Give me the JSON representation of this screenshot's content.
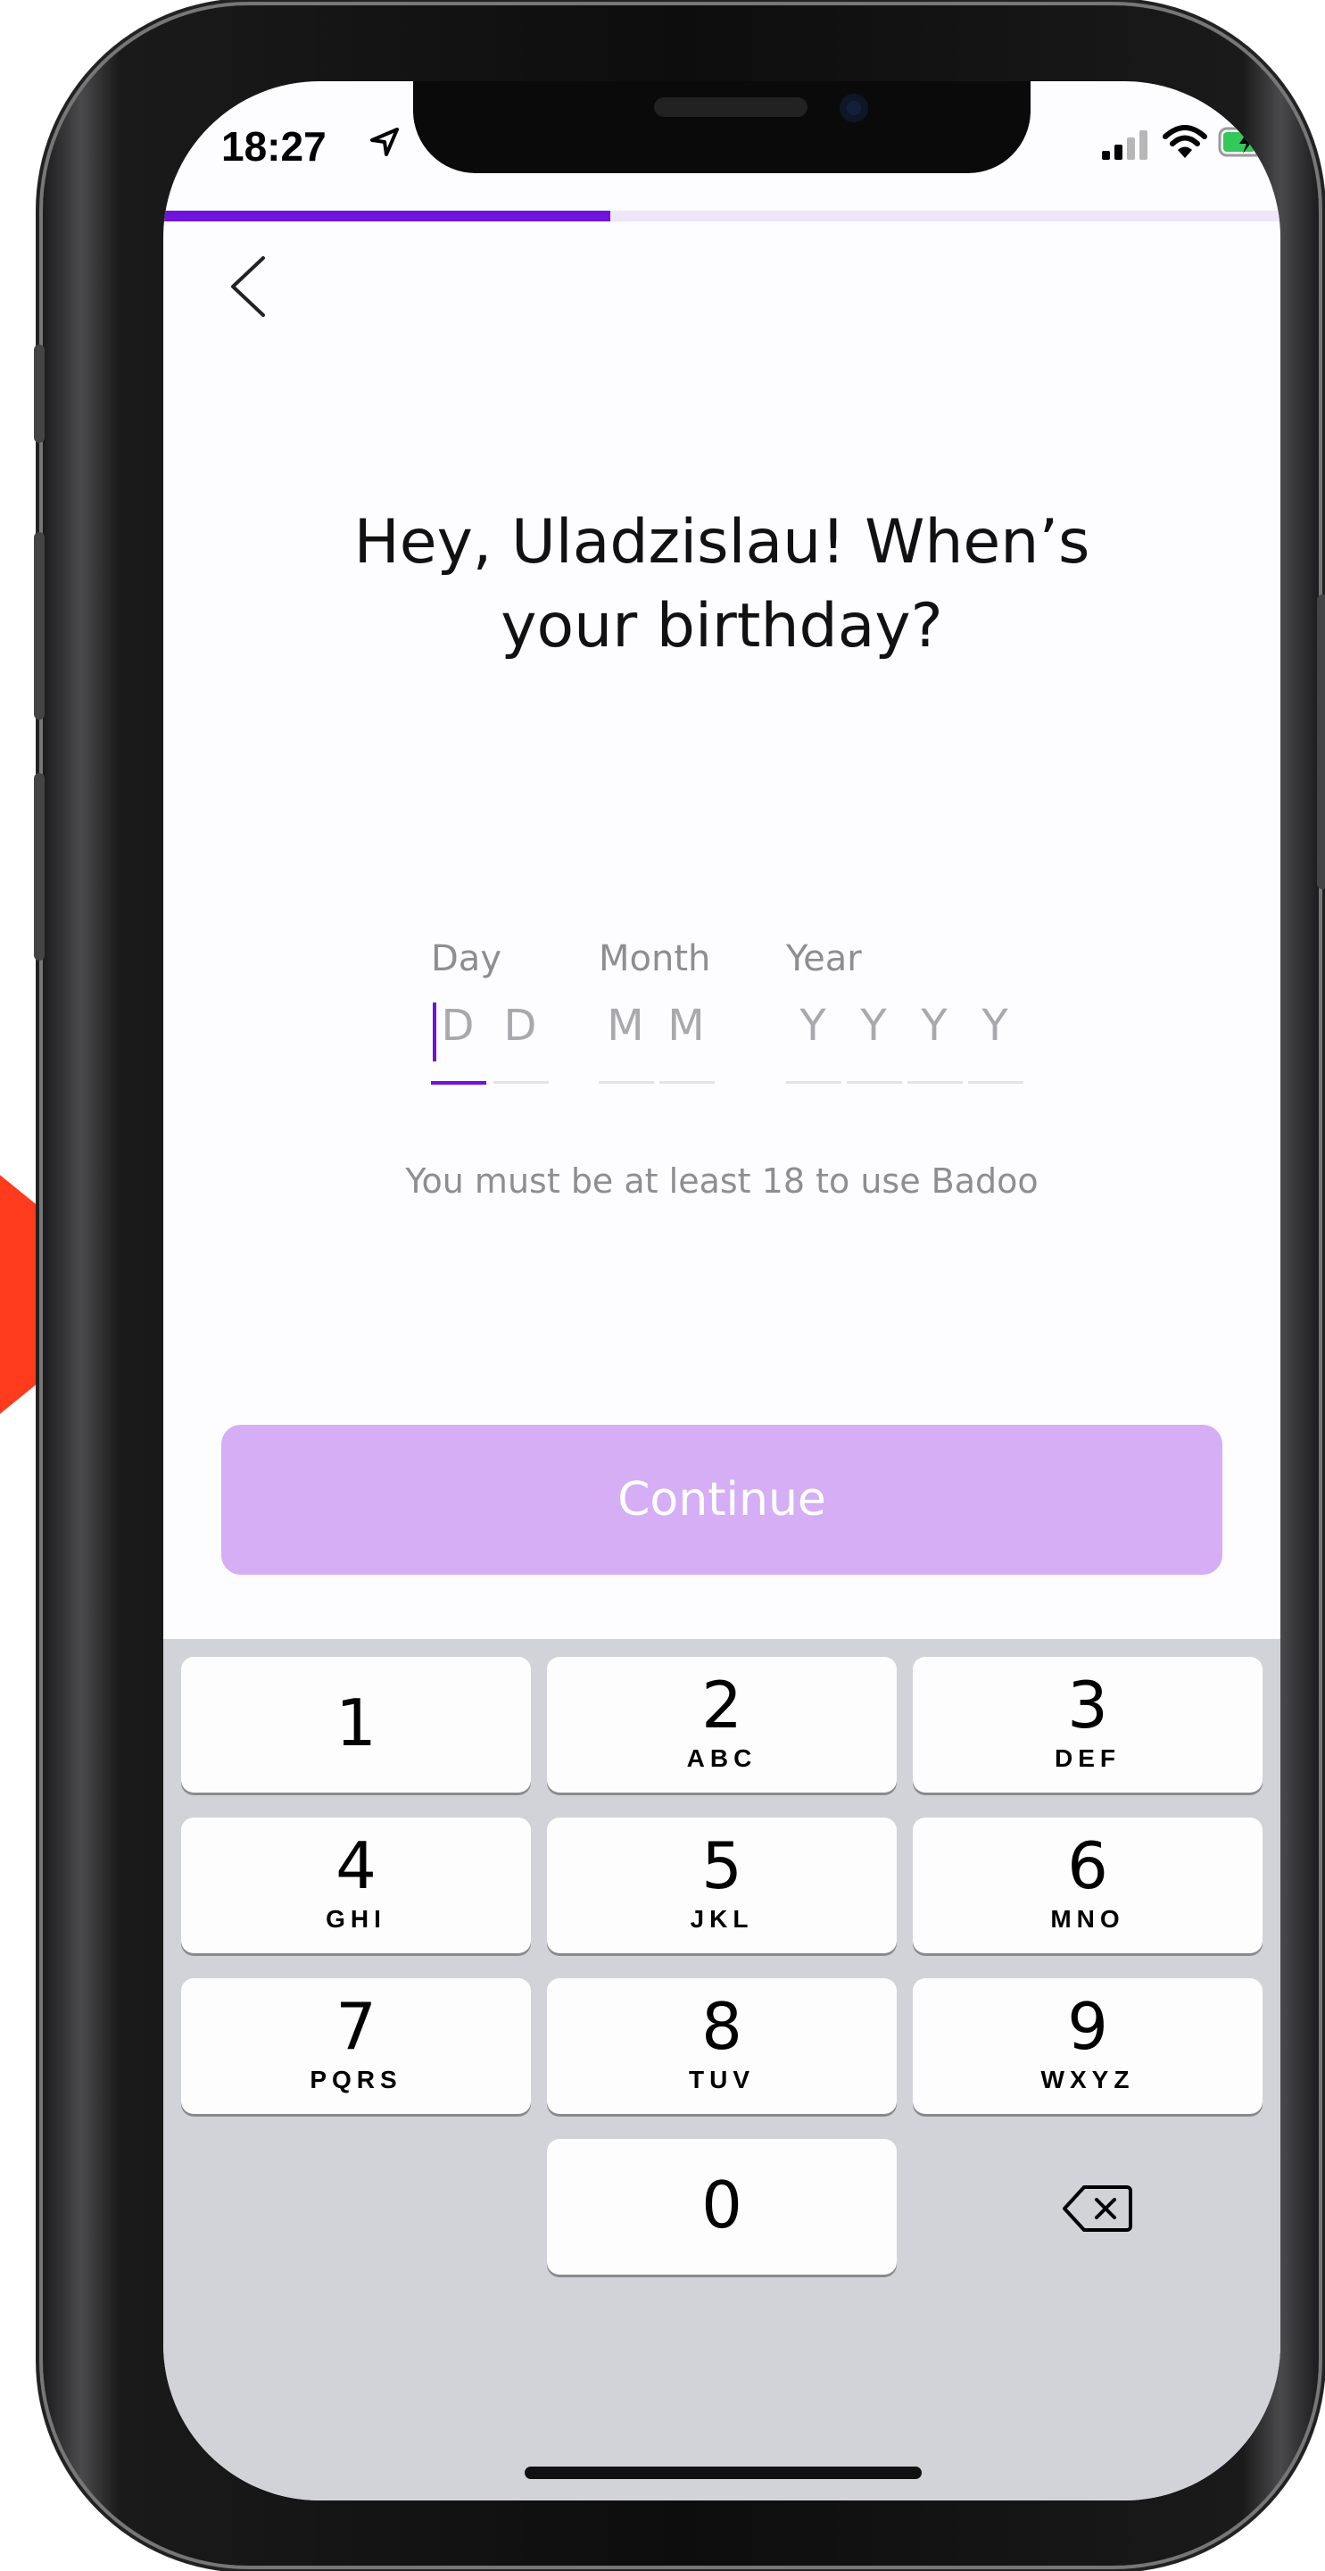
{
  "status_bar": {
    "time": "18:27"
  },
  "progress": {
    "fraction": 0.4
  },
  "title": {
    "line1": "Hey, Uladzislau! When’s",
    "line2": "your birthday?"
  },
  "birthday": {
    "day_label": "Day",
    "month_label": "Month",
    "year_label": "Year",
    "day_placeholder": [
      "D",
      "D"
    ],
    "month_placeholder": [
      "M",
      "M"
    ],
    "year_placeholder": [
      "Y",
      "Y",
      "Y",
      "Y"
    ]
  },
  "hint": "You must be at least 18 to use Badoo",
  "continue_label": "Continue",
  "keypad": {
    "keys": [
      {
        "num": "1",
        "letters": ""
      },
      {
        "num": "2",
        "letters": "ABC"
      },
      {
        "num": "3",
        "letters": "DEF"
      },
      {
        "num": "4",
        "letters": "GHI"
      },
      {
        "num": "5",
        "letters": "JKL"
      },
      {
        "num": "6",
        "letters": "MNO"
      },
      {
        "num": "7",
        "letters": "PQRS"
      },
      {
        "num": "8",
        "letters": "TUV"
      },
      {
        "num": "9",
        "letters": "WXYZ"
      },
      {
        "num": "0",
        "letters": ""
      }
    ]
  },
  "colors": {
    "accent": "#6e14dc",
    "button_disabled": "#d5aef5",
    "keyboard_bg": "#d1d3d9",
    "arrow": "#ff3b1d"
  }
}
